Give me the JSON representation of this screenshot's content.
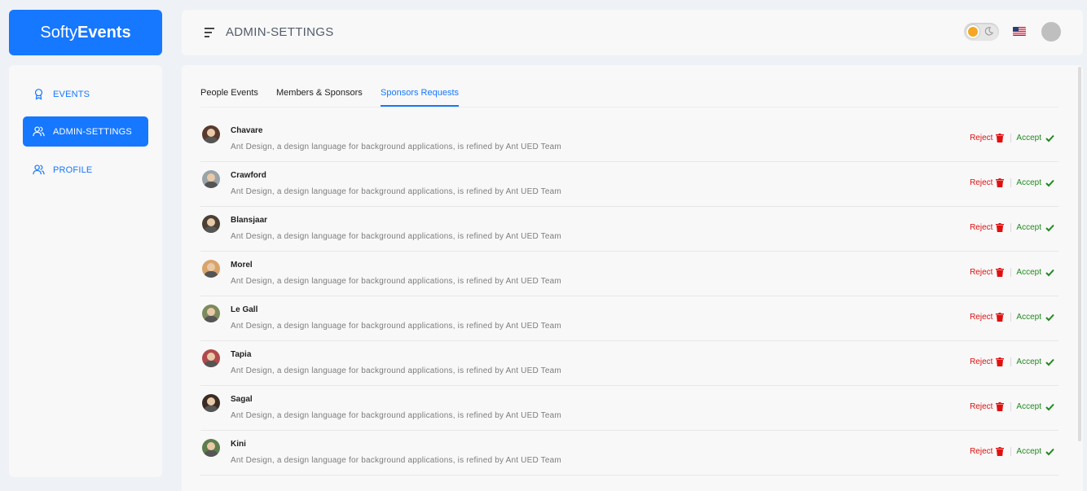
{
  "brand": {
    "prefix": "Softy",
    "suffix": "Events"
  },
  "sidebar": {
    "items": [
      {
        "label": "EVENTS",
        "icon": "award-icon",
        "active": false
      },
      {
        "label": "ADMIN-SETTINGS",
        "icon": "users-icon",
        "active": true
      },
      {
        "label": "PROFILE",
        "icon": "users-icon",
        "active": false
      }
    ]
  },
  "header": {
    "title": "ADMIN-SETTINGS",
    "language": "us-flag-icon"
  },
  "tabs": [
    {
      "label": "People Events",
      "active": false
    },
    {
      "label": "Members & Sponsors",
      "active": false
    },
    {
      "label": "Sponsors Requests",
      "active": true
    }
  ],
  "requests": [
    {
      "name": "Chavare",
      "description": "Ant Design, a design language for background applications, is refined by Ant UED Team",
      "reject_label": "Reject",
      "accept_label": "Accept"
    },
    {
      "name": "Crawford",
      "description": "Ant Design, a design language for background applications, is refined by Ant UED Team",
      "reject_label": "Reject",
      "accept_label": "Accept"
    },
    {
      "name": "Blansjaar",
      "description": "Ant Design, a design language for background applications, is refined by Ant UED Team",
      "reject_label": "Reject",
      "accept_label": "Accept"
    },
    {
      "name": "Morel",
      "description": "Ant Design, a design language for background applications, is refined by Ant UED Team",
      "reject_label": "Reject",
      "accept_label": "Accept"
    },
    {
      "name": "Le Gall",
      "description": "Ant Design, a design language for background applications, is refined by Ant UED Team",
      "reject_label": "Reject",
      "accept_label": "Accept"
    },
    {
      "name": "Tapia",
      "description": "Ant Design, a design language for background applications, is refined by Ant UED Team",
      "reject_label": "Reject",
      "accept_label": "Accept"
    },
    {
      "name": "Sagal",
      "description": "Ant Design, a design language for background applications, is refined by Ant UED Team",
      "reject_label": "Reject",
      "accept_label": "Accept"
    },
    {
      "name": "Kini",
      "description": "Ant Design, a design language for background applications, is refined by Ant UED Team",
      "reject_label": "Reject",
      "accept_label": "Accept"
    }
  ],
  "colors": {
    "primary": "#1677ff",
    "reject": "#e01010",
    "accept": "#1f8a1f",
    "avatars": [
      "#5a3a2e",
      "#9aa3a8",
      "#4b4033",
      "#d9a46a",
      "#7d8a5c",
      "#b04a4a",
      "#3b2b24",
      "#5e7d4e"
    ]
  }
}
